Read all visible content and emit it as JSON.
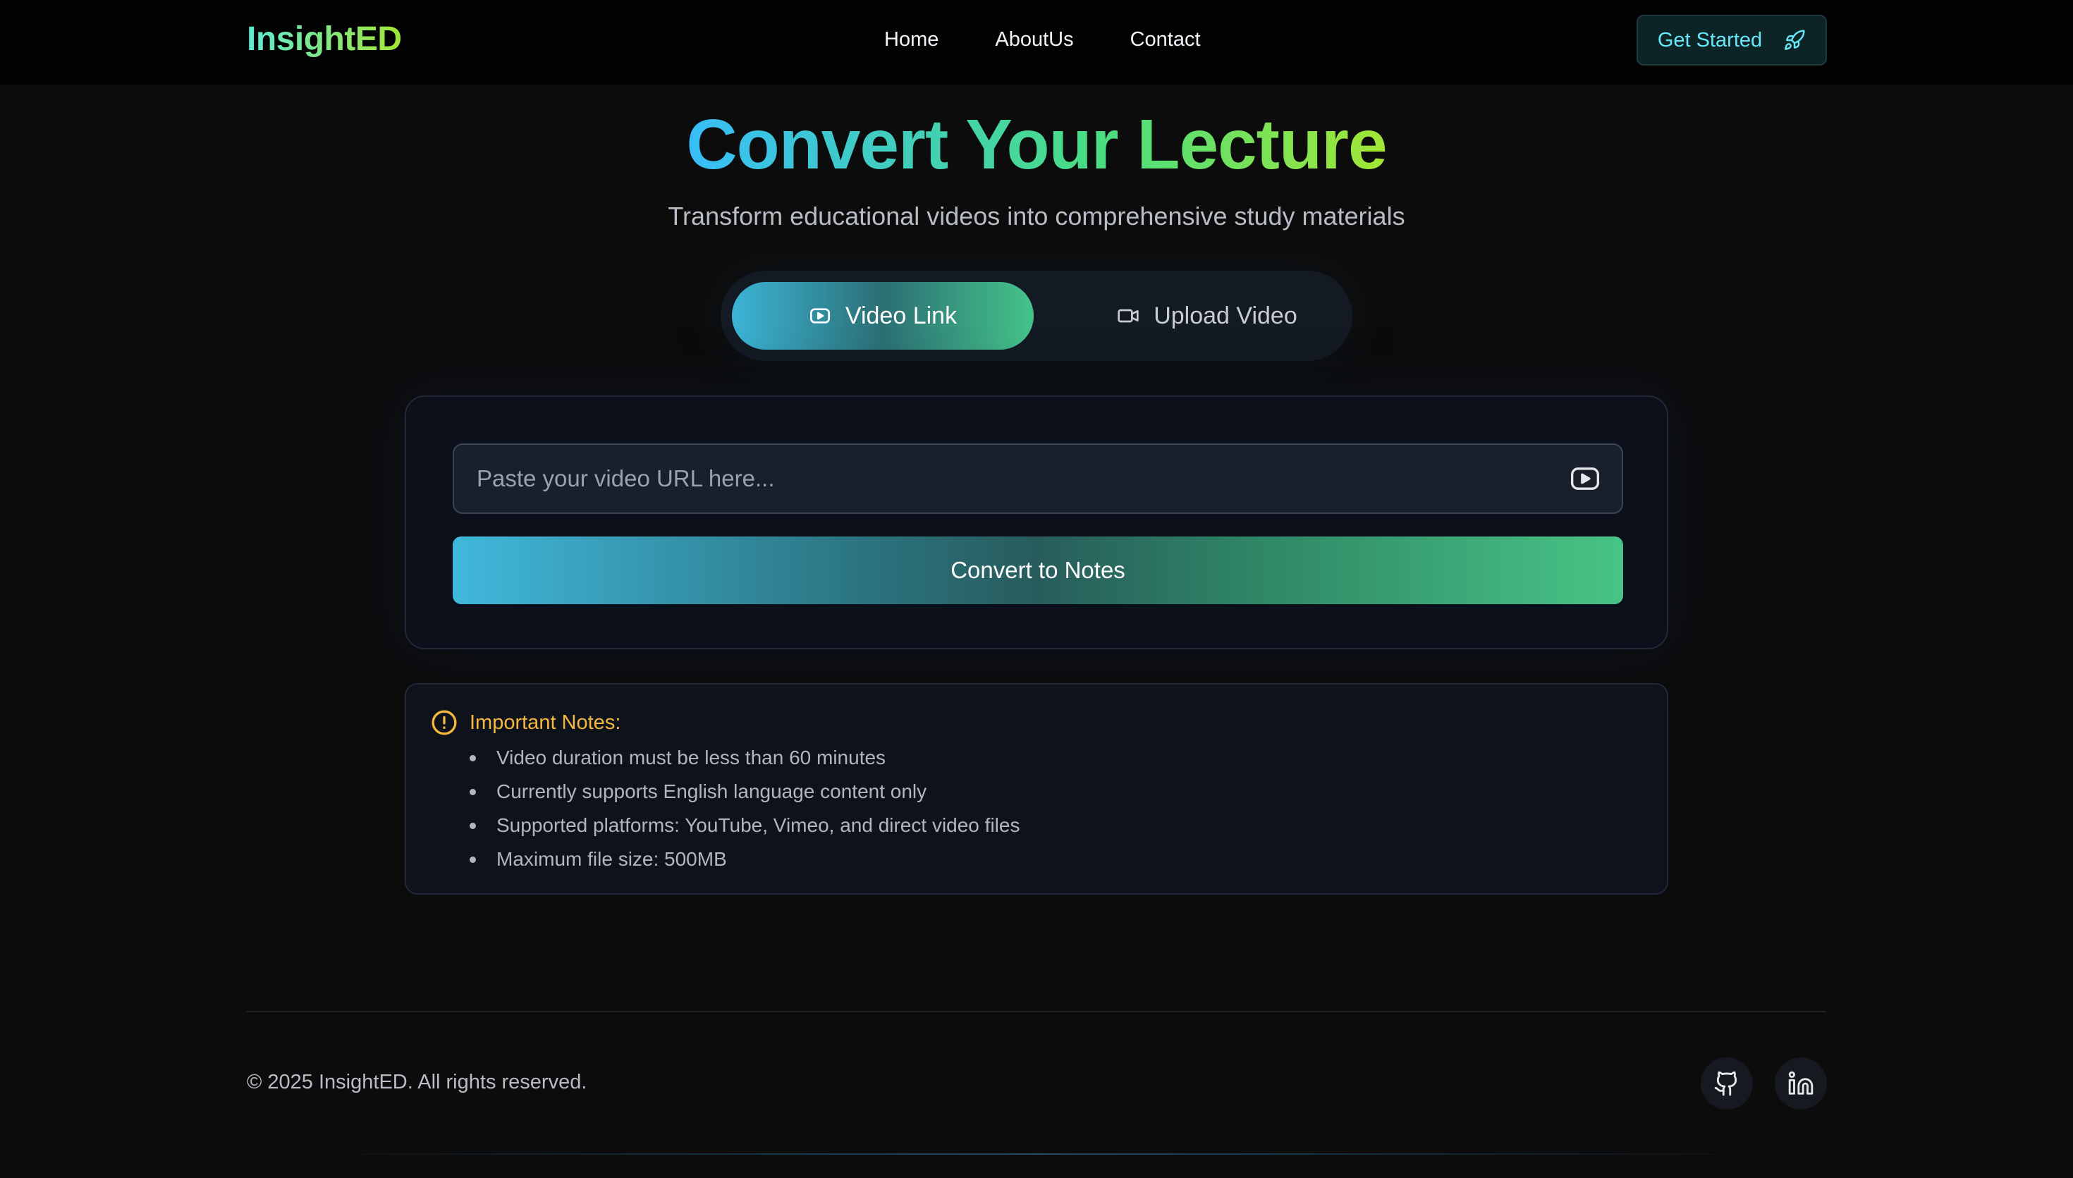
{
  "app": {
    "brand": "InsightED"
  },
  "nav": {
    "links": [
      "Home",
      "AboutUs",
      "Contact"
    ],
    "cta_label": "Get Started"
  },
  "hero": {
    "title": "Convert Your Lecture",
    "subtitle": "Transform educational videos into comprehensive study materials"
  },
  "tabs": [
    {
      "label": "Video Link",
      "icon": "youtube-icon",
      "active": true
    },
    {
      "label": "Upload Video",
      "icon": "video-camera-icon",
      "active": false
    }
  ],
  "form": {
    "url_value": "",
    "url_placeholder": "Paste your video URL here...",
    "submit_label": "Convert to Notes"
  },
  "notes": {
    "title": "Important Notes:",
    "items": [
      "Video duration must be less than 60 minutes",
      "Currently supports English language content only",
      "Supported platforms: YouTube, Vimeo, and direct video files",
      "Maximum file size: 500MB"
    ]
  },
  "footer": {
    "copyright": "© 2025 InsightED. All rights reserved.",
    "social": [
      "github-icon",
      "linkedin-icon"
    ]
  },
  "colors": {
    "background": "#0c0c0d",
    "navbar": "#020202",
    "accent_cyan": "#3cb4d6",
    "accent_green": "#45c48a",
    "warning": "#f5b83d"
  }
}
